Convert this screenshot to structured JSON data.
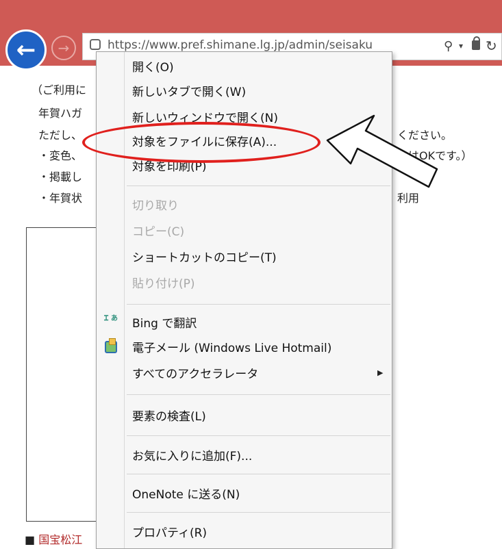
{
  "browser": {
    "address_text": "https://www.pref.shimane.lg.jp/admin/seisaku",
    "back_glyph": "←",
    "forward_glyph": "→",
    "search_glyph": "⚲",
    "caret_glyph": "▾",
    "refresh_glyph": "↻"
  },
  "page": {
    "lines": [
      "（ご利用に",
      "年賀ハガ",
      "ただし、",
      "・変色、",
      "・掲載し",
      "・年賀状"
    ],
    "right_fragments": [
      "ください。",
      "はOKです。）",
      "利用"
    ],
    "footer_bullet": "■",
    "footer_link": "国宝松江"
  },
  "context_menu": {
    "items": [
      {
        "label": "開く(O)",
        "disabled": false
      },
      {
        "label": "新しいタブで開く(W)",
        "disabled": false
      },
      {
        "label": "新しいウィンドウで開く(N)",
        "disabled": false
      },
      {
        "label": "対象をファイルに保存(A)...",
        "disabled": false,
        "highlighted": true
      },
      {
        "label": "対象を印刷(P)",
        "disabled": false
      },
      {
        "label": "切り取り",
        "disabled": true
      },
      {
        "label": "コピー(C)",
        "disabled": true
      },
      {
        "label": "ショートカットのコピー(T)",
        "disabled": false
      },
      {
        "label": "貼り付け(P)",
        "disabled": true
      },
      {
        "label": "Bing で翻訳",
        "disabled": false,
        "icon": "bing-translate-icon"
      },
      {
        "label": "電子メール (Windows Live Hotmail)",
        "disabled": false,
        "icon": "mail-icon"
      },
      {
        "label": "すべてのアクセラレータ",
        "disabled": false,
        "submenu": true
      },
      {
        "label": "要素の検査(L)",
        "disabled": false
      },
      {
        "label": "お気に入りに追加(F)...",
        "disabled": false
      },
      {
        "label": "OneNote に送る(N)",
        "disabled": false
      },
      {
        "label": "プロパティ(R)",
        "disabled": false
      }
    ],
    "submenu_glyph": "▶",
    "bing_icon_text": "Ꮖ あ"
  },
  "colors": {
    "toolbar": "#cf5a55",
    "back_button": "#1f62c4",
    "annotation_red": "#e0201d",
    "link_red": "#b22a2a"
  }
}
